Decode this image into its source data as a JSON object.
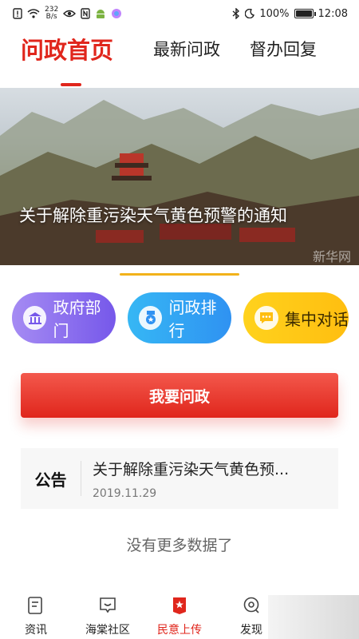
{
  "status_bar": {
    "net_speed_value": "232",
    "net_speed_unit": "B/s",
    "battery": "100%",
    "time": "12:08",
    "battery_level": 1.0
  },
  "tabs": [
    {
      "label": "问政首页",
      "active": true
    },
    {
      "label": "最新问政",
      "active": false
    },
    {
      "label": "督办回复",
      "active": false
    }
  ],
  "banner": {
    "title": "关于解除重污染天气黄色预警的通知",
    "watermark": "新华网"
  },
  "categories": [
    {
      "label": "政府部门",
      "icon": "building-icon"
    },
    {
      "label": "问政排行",
      "icon": "ranking-icon"
    },
    {
      "label": "集中对话",
      "icon": "chat-icon"
    }
  ],
  "ask_button": "我要问政",
  "notice": {
    "tag": "公告",
    "title": "关于解除重污染天气黄色预...",
    "date": "2019.11.29"
  },
  "empty_text": "没有更多数据了",
  "bottom_nav": [
    {
      "label": "资讯",
      "icon": "news-icon"
    },
    {
      "label": "海棠社区",
      "icon": "community-icon"
    },
    {
      "label": "民意上传",
      "icon": "upload-icon",
      "active": true
    },
    {
      "label": "发现",
      "icon": "discover-icon"
    }
  ],
  "colors": {
    "accent": "#e0261c",
    "purple": "#7658ea",
    "blue": "#2f92f2",
    "yellow": "#ffbe10"
  }
}
